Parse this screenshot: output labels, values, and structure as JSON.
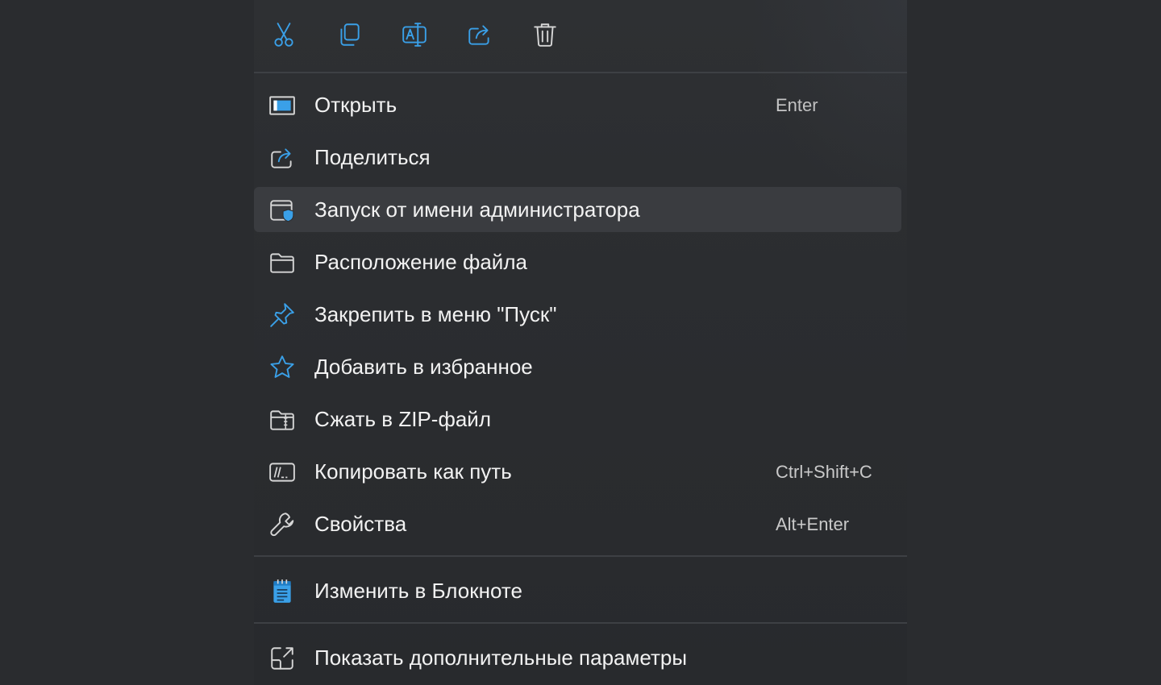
{
  "colors": {
    "background": "#2a2c2f",
    "menu_bg": "#2d2f32",
    "hover_bg": "#3a3c40",
    "separator": "#3d4044",
    "accent": "#3aa0e8",
    "icon": "#d6d6d6",
    "text": "#f2f2f2",
    "shortcut": "#c9c9c9"
  },
  "toolbar": {
    "buttons": [
      {
        "icon": "scissors-icon"
      },
      {
        "icon": "copy-icon"
      },
      {
        "icon": "rename-icon"
      },
      {
        "icon": "share-icon"
      },
      {
        "icon": "trash-icon"
      }
    ]
  },
  "menu": {
    "items": [
      {
        "label": "Открыть",
        "shortcut": "Enter",
        "icon": "open-app-icon"
      },
      {
        "label": "Поделиться",
        "shortcut": "",
        "icon": "share-icon"
      },
      {
        "label": "Запуск от имени администратора",
        "shortcut": "",
        "icon": "admin-shield-icon",
        "highlighted": true
      },
      {
        "label": "Расположение файла",
        "shortcut": "",
        "icon": "folder-icon"
      },
      {
        "label": "Закрепить в меню \"Пуск\"",
        "shortcut": "",
        "icon": "pin-icon"
      },
      {
        "label": "Добавить в избранное",
        "shortcut": "",
        "icon": "star-icon"
      },
      {
        "label": "Сжать в ZIP-файл",
        "shortcut": "",
        "icon": "zip-folder-icon"
      },
      {
        "label": "Копировать как путь",
        "shortcut": "Ctrl+Shift+C",
        "icon": "copy-path-icon"
      },
      {
        "label": "Свойства",
        "shortcut": "Alt+Enter",
        "icon": "wrench-icon"
      },
      {
        "label": "Изменить в Блокноте",
        "shortcut": "",
        "icon": "notepad-icon"
      },
      {
        "label": "Показать дополнительные параметры",
        "shortcut": "",
        "icon": "more-options-icon"
      }
    ]
  }
}
